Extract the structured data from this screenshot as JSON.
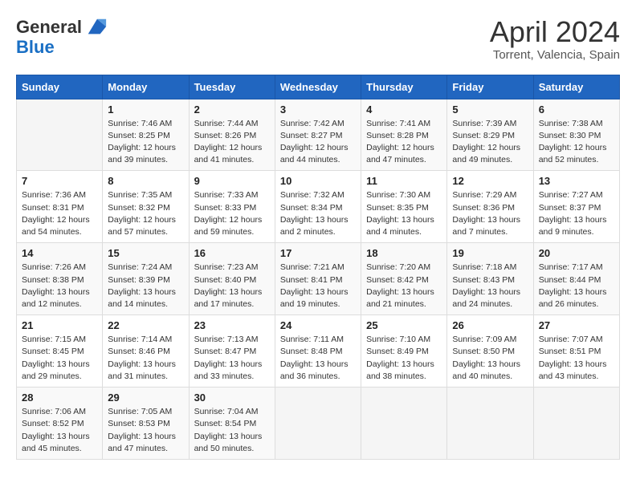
{
  "header": {
    "logo_general": "General",
    "logo_blue": "Blue",
    "title": "April 2024",
    "subtitle": "Torrent, Valencia, Spain"
  },
  "calendar": {
    "weekdays": [
      "Sunday",
      "Monday",
      "Tuesday",
      "Wednesday",
      "Thursday",
      "Friday",
      "Saturday"
    ],
    "weeks": [
      [
        {
          "day": "",
          "sunrise": "",
          "sunset": "",
          "daylight": ""
        },
        {
          "day": "1",
          "sunrise": "Sunrise: 7:46 AM",
          "sunset": "Sunset: 8:25 PM",
          "daylight": "Daylight: 12 hours and 39 minutes."
        },
        {
          "day": "2",
          "sunrise": "Sunrise: 7:44 AM",
          "sunset": "Sunset: 8:26 PM",
          "daylight": "Daylight: 12 hours and 41 minutes."
        },
        {
          "day": "3",
          "sunrise": "Sunrise: 7:42 AM",
          "sunset": "Sunset: 8:27 PM",
          "daylight": "Daylight: 12 hours and 44 minutes."
        },
        {
          "day": "4",
          "sunrise": "Sunrise: 7:41 AM",
          "sunset": "Sunset: 8:28 PM",
          "daylight": "Daylight: 12 hours and 47 minutes."
        },
        {
          "day": "5",
          "sunrise": "Sunrise: 7:39 AM",
          "sunset": "Sunset: 8:29 PM",
          "daylight": "Daylight: 12 hours and 49 minutes."
        },
        {
          "day": "6",
          "sunrise": "Sunrise: 7:38 AM",
          "sunset": "Sunset: 8:30 PM",
          "daylight": "Daylight: 12 hours and 52 minutes."
        }
      ],
      [
        {
          "day": "7",
          "sunrise": "Sunrise: 7:36 AM",
          "sunset": "Sunset: 8:31 PM",
          "daylight": "Daylight: 12 hours and 54 minutes."
        },
        {
          "day": "8",
          "sunrise": "Sunrise: 7:35 AM",
          "sunset": "Sunset: 8:32 PM",
          "daylight": "Daylight: 12 hours and 57 minutes."
        },
        {
          "day": "9",
          "sunrise": "Sunrise: 7:33 AM",
          "sunset": "Sunset: 8:33 PM",
          "daylight": "Daylight: 12 hours and 59 minutes."
        },
        {
          "day": "10",
          "sunrise": "Sunrise: 7:32 AM",
          "sunset": "Sunset: 8:34 PM",
          "daylight": "Daylight: 13 hours and 2 minutes."
        },
        {
          "day": "11",
          "sunrise": "Sunrise: 7:30 AM",
          "sunset": "Sunset: 8:35 PM",
          "daylight": "Daylight: 13 hours and 4 minutes."
        },
        {
          "day": "12",
          "sunrise": "Sunrise: 7:29 AM",
          "sunset": "Sunset: 8:36 PM",
          "daylight": "Daylight: 13 hours and 7 minutes."
        },
        {
          "day": "13",
          "sunrise": "Sunrise: 7:27 AM",
          "sunset": "Sunset: 8:37 PM",
          "daylight": "Daylight: 13 hours and 9 minutes."
        }
      ],
      [
        {
          "day": "14",
          "sunrise": "Sunrise: 7:26 AM",
          "sunset": "Sunset: 8:38 PM",
          "daylight": "Daylight: 13 hours and 12 minutes."
        },
        {
          "day": "15",
          "sunrise": "Sunrise: 7:24 AM",
          "sunset": "Sunset: 8:39 PM",
          "daylight": "Daylight: 13 hours and 14 minutes."
        },
        {
          "day": "16",
          "sunrise": "Sunrise: 7:23 AM",
          "sunset": "Sunset: 8:40 PM",
          "daylight": "Daylight: 13 hours and 17 minutes."
        },
        {
          "day": "17",
          "sunrise": "Sunrise: 7:21 AM",
          "sunset": "Sunset: 8:41 PM",
          "daylight": "Daylight: 13 hours and 19 minutes."
        },
        {
          "day": "18",
          "sunrise": "Sunrise: 7:20 AM",
          "sunset": "Sunset: 8:42 PM",
          "daylight": "Daylight: 13 hours and 21 minutes."
        },
        {
          "day": "19",
          "sunrise": "Sunrise: 7:18 AM",
          "sunset": "Sunset: 8:43 PM",
          "daylight": "Daylight: 13 hours and 24 minutes."
        },
        {
          "day": "20",
          "sunrise": "Sunrise: 7:17 AM",
          "sunset": "Sunset: 8:44 PM",
          "daylight": "Daylight: 13 hours and 26 minutes."
        }
      ],
      [
        {
          "day": "21",
          "sunrise": "Sunrise: 7:15 AM",
          "sunset": "Sunset: 8:45 PM",
          "daylight": "Daylight: 13 hours and 29 minutes."
        },
        {
          "day": "22",
          "sunrise": "Sunrise: 7:14 AM",
          "sunset": "Sunset: 8:46 PM",
          "daylight": "Daylight: 13 hours and 31 minutes."
        },
        {
          "day": "23",
          "sunrise": "Sunrise: 7:13 AM",
          "sunset": "Sunset: 8:47 PM",
          "daylight": "Daylight: 13 hours and 33 minutes."
        },
        {
          "day": "24",
          "sunrise": "Sunrise: 7:11 AM",
          "sunset": "Sunset: 8:48 PM",
          "daylight": "Daylight: 13 hours and 36 minutes."
        },
        {
          "day": "25",
          "sunrise": "Sunrise: 7:10 AM",
          "sunset": "Sunset: 8:49 PM",
          "daylight": "Daylight: 13 hours and 38 minutes."
        },
        {
          "day": "26",
          "sunrise": "Sunrise: 7:09 AM",
          "sunset": "Sunset: 8:50 PM",
          "daylight": "Daylight: 13 hours and 40 minutes."
        },
        {
          "day": "27",
          "sunrise": "Sunrise: 7:07 AM",
          "sunset": "Sunset: 8:51 PM",
          "daylight": "Daylight: 13 hours and 43 minutes."
        }
      ],
      [
        {
          "day": "28",
          "sunrise": "Sunrise: 7:06 AM",
          "sunset": "Sunset: 8:52 PM",
          "daylight": "Daylight: 13 hours and 45 minutes."
        },
        {
          "day": "29",
          "sunrise": "Sunrise: 7:05 AM",
          "sunset": "Sunset: 8:53 PM",
          "daylight": "Daylight: 13 hours and 47 minutes."
        },
        {
          "day": "30",
          "sunrise": "Sunrise: 7:04 AM",
          "sunset": "Sunset: 8:54 PM",
          "daylight": "Daylight: 13 hours and 50 minutes."
        },
        {
          "day": "",
          "sunrise": "",
          "sunset": "",
          "daylight": ""
        },
        {
          "day": "",
          "sunrise": "",
          "sunset": "",
          "daylight": ""
        },
        {
          "day": "",
          "sunrise": "",
          "sunset": "",
          "daylight": ""
        },
        {
          "day": "",
          "sunrise": "",
          "sunset": "",
          "daylight": ""
        }
      ]
    ]
  }
}
